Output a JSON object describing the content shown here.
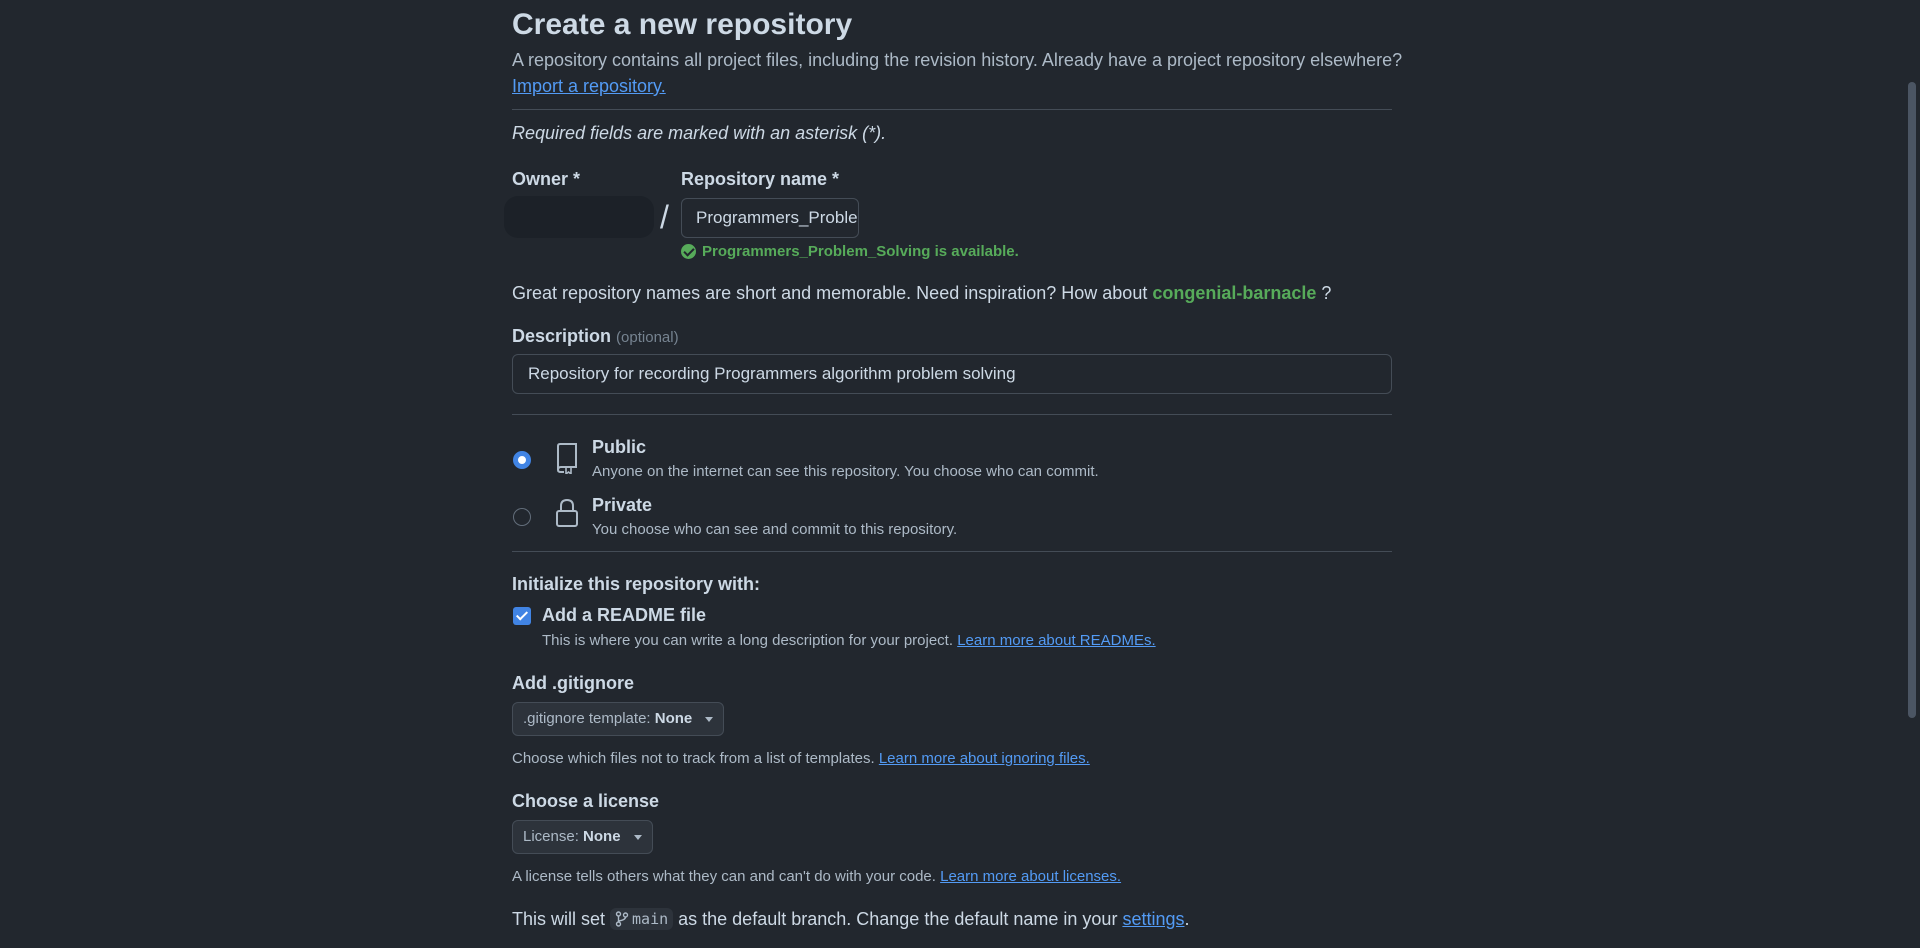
{
  "header": {
    "title": "Create a new repository",
    "subtitle": "A repository contains all project files, including the revision history. Already have a project repository elsewhere?",
    "import_link": "Import a repository."
  },
  "required_note": "Required fields are marked with an asterisk (*).",
  "owner": {
    "label": "Owner *"
  },
  "separator": "/",
  "repo_name": {
    "label": "Repository name *",
    "value": "Programmers_Problem_Sol",
    "availability": "Programmers_Problem_Solving is available."
  },
  "inspiration": {
    "text": "Great repository names are short and memorable. Need inspiration? How about",
    "suggestion": "congenial-barnacle",
    "suffix": "?"
  },
  "description": {
    "label": "Description",
    "optional": "(optional)",
    "value": "Repository for recording Programmers algorithm problem solving"
  },
  "visibility": {
    "selected": "Public",
    "public": {
      "title": "Public",
      "desc": "Anyone on the internet can see this repository. You choose who can commit."
    },
    "private": {
      "title": "Private",
      "desc": "You choose who can see and commit to this repository."
    }
  },
  "init": {
    "heading": "Initialize this repository with:",
    "readme": {
      "label": "Add a README file",
      "checked": true,
      "desc": "This is where you can write a long description for your project.",
      "link": "Learn more about READMEs."
    }
  },
  "gitignore": {
    "heading": "Add .gitignore",
    "dropdown_label": ".gitignore template:",
    "dropdown_value": "None",
    "desc": "Choose which files not to track from a list of templates.",
    "link": "Learn more about ignoring files."
  },
  "license": {
    "heading": "Choose a license",
    "dropdown_label": "License:",
    "dropdown_value": "None",
    "desc": "A license tells others what they can and can't do with your code.",
    "link": "Learn more about licenses."
  },
  "branch": {
    "prefix": "This will set",
    "name": "main",
    "middle": "as the default branch. Change the default name in your",
    "link": "settings",
    "suffix": "."
  },
  "colors": {
    "background": "#22272e",
    "text": "#adbac7",
    "heading": "#cdd9e5",
    "link": "#539bf5",
    "success": "#57ab5a",
    "accent": "#4184e4",
    "border": "#444c56"
  },
  "icons": {
    "public": "repo-icon",
    "private": "lock-icon",
    "available": "check-circle-icon",
    "branch": "git-branch-icon",
    "dropdown": "triangle-down-icon"
  }
}
